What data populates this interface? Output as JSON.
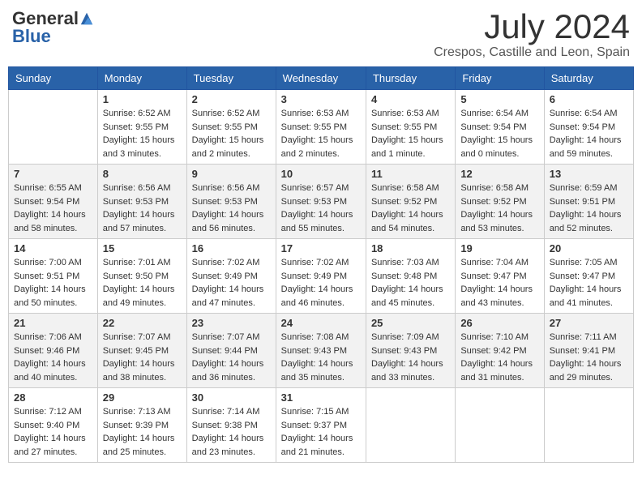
{
  "logo": {
    "general": "General",
    "blue": "Blue"
  },
  "title": {
    "month_year": "July 2024",
    "location": "Crespos, Castille and Leon, Spain"
  },
  "headers": [
    "Sunday",
    "Monday",
    "Tuesday",
    "Wednesday",
    "Thursday",
    "Friday",
    "Saturday"
  ],
  "weeks": [
    [
      {
        "day": "",
        "info": ""
      },
      {
        "day": "1",
        "info": "Sunrise: 6:52 AM\nSunset: 9:55 PM\nDaylight: 15 hours\nand 3 minutes."
      },
      {
        "day": "2",
        "info": "Sunrise: 6:52 AM\nSunset: 9:55 PM\nDaylight: 15 hours\nand 2 minutes."
      },
      {
        "day": "3",
        "info": "Sunrise: 6:53 AM\nSunset: 9:55 PM\nDaylight: 15 hours\nand 2 minutes."
      },
      {
        "day": "4",
        "info": "Sunrise: 6:53 AM\nSunset: 9:55 PM\nDaylight: 15 hours\nand 1 minute."
      },
      {
        "day": "5",
        "info": "Sunrise: 6:54 AM\nSunset: 9:54 PM\nDaylight: 15 hours\nand 0 minutes."
      },
      {
        "day": "6",
        "info": "Sunrise: 6:54 AM\nSunset: 9:54 PM\nDaylight: 14 hours\nand 59 minutes."
      }
    ],
    [
      {
        "day": "7",
        "info": "Sunrise: 6:55 AM\nSunset: 9:54 PM\nDaylight: 14 hours\nand 58 minutes."
      },
      {
        "day": "8",
        "info": "Sunrise: 6:56 AM\nSunset: 9:53 PM\nDaylight: 14 hours\nand 57 minutes."
      },
      {
        "day": "9",
        "info": "Sunrise: 6:56 AM\nSunset: 9:53 PM\nDaylight: 14 hours\nand 56 minutes."
      },
      {
        "day": "10",
        "info": "Sunrise: 6:57 AM\nSunset: 9:53 PM\nDaylight: 14 hours\nand 55 minutes."
      },
      {
        "day": "11",
        "info": "Sunrise: 6:58 AM\nSunset: 9:52 PM\nDaylight: 14 hours\nand 54 minutes."
      },
      {
        "day": "12",
        "info": "Sunrise: 6:58 AM\nSunset: 9:52 PM\nDaylight: 14 hours\nand 53 minutes."
      },
      {
        "day": "13",
        "info": "Sunrise: 6:59 AM\nSunset: 9:51 PM\nDaylight: 14 hours\nand 52 minutes."
      }
    ],
    [
      {
        "day": "14",
        "info": "Sunrise: 7:00 AM\nSunset: 9:51 PM\nDaylight: 14 hours\nand 50 minutes."
      },
      {
        "day": "15",
        "info": "Sunrise: 7:01 AM\nSunset: 9:50 PM\nDaylight: 14 hours\nand 49 minutes."
      },
      {
        "day": "16",
        "info": "Sunrise: 7:02 AM\nSunset: 9:49 PM\nDaylight: 14 hours\nand 47 minutes."
      },
      {
        "day": "17",
        "info": "Sunrise: 7:02 AM\nSunset: 9:49 PM\nDaylight: 14 hours\nand 46 minutes."
      },
      {
        "day": "18",
        "info": "Sunrise: 7:03 AM\nSunset: 9:48 PM\nDaylight: 14 hours\nand 45 minutes."
      },
      {
        "day": "19",
        "info": "Sunrise: 7:04 AM\nSunset: 9:47 PM\nDaylight: 14 hours\nand 43 minutes."
      },
      {
        "day": "20",
        "info": "Sunrise: 7:05 AM\nSunset: 9:47 PM\nDaylight: 14 hours\nand 41 minutes."
      }
    ],
    [
      {
        "day": "21",
        "info": "Sunrise: 7:06 AM\nSunset: 9:46 PM\nDaylight: 14 hours\nand 40 minutes."
      },
      {
        "day": "22",
        "info": "Sunrise: 7:07 AM\nSunset: 9:45 PM\nDaylight: 14 hours\nand 38 minutes."
      },
      {
        "day": "23",
        "info": "Sunrise: 7:07 AM\nSunset: 9:44 PM\nDaylight: 14 hours\nand 36 minutes."
      },
      {
        "day": "24",
        "info": "Sunrise: 7:08 AM\nSunset: 9:43 PM\nDaylight: 14 hours\nand 35 minutes."
      },
      {
        "day": "25",
        "info": "Sunrise: 7:09 AM\nSunset: 9:43 PM\nDaylight: 14 hours\nand 33 minutes."
      },
      {
        "day": "26",
        "info": "Sunrise: 7:10 AM\nSunset: 9:42 PM\nDaylight: 14 hours\nand 31 minutes."
      },
      {
        "day": "27",
        "info": "Sunrise: 7:11 AM\nSunset: 9:41 PM\nDaylight: 14 hours\nand 29 minutes."
      }
    ],
    [
      {
        "day": "28",
        "info": "Sunrise: 7:12 AM\nSunset: 9:40 PM\nDaylight: 14 hours\nand 27 minutes."
      },
      {
        "day": "29",
        "info": "Sunrise: 7:13 AM\nSunset: 9:39 PM\nDaylight: 14 hours\nand 25 minutes."
      },
      {
        "day": "30",
        "info": "Sunrise: 7:14 AM\nSunset: 9:38 PM\nDaylight: 14 hours\nand 23 minutes."
      },
      {
        "day": "31",
        "info": "Sunrise: 7:15 AM\nSunset: 9:37 PM\nDaylight: 14 hours\nand 21 minutes."
      },
      {
        "day": "",
        "info": ""
      },
      {
        "day": "",
        "info": ""
      },
      {
        "day": "",
        "info": ""
      }
    ]
  ]
}
